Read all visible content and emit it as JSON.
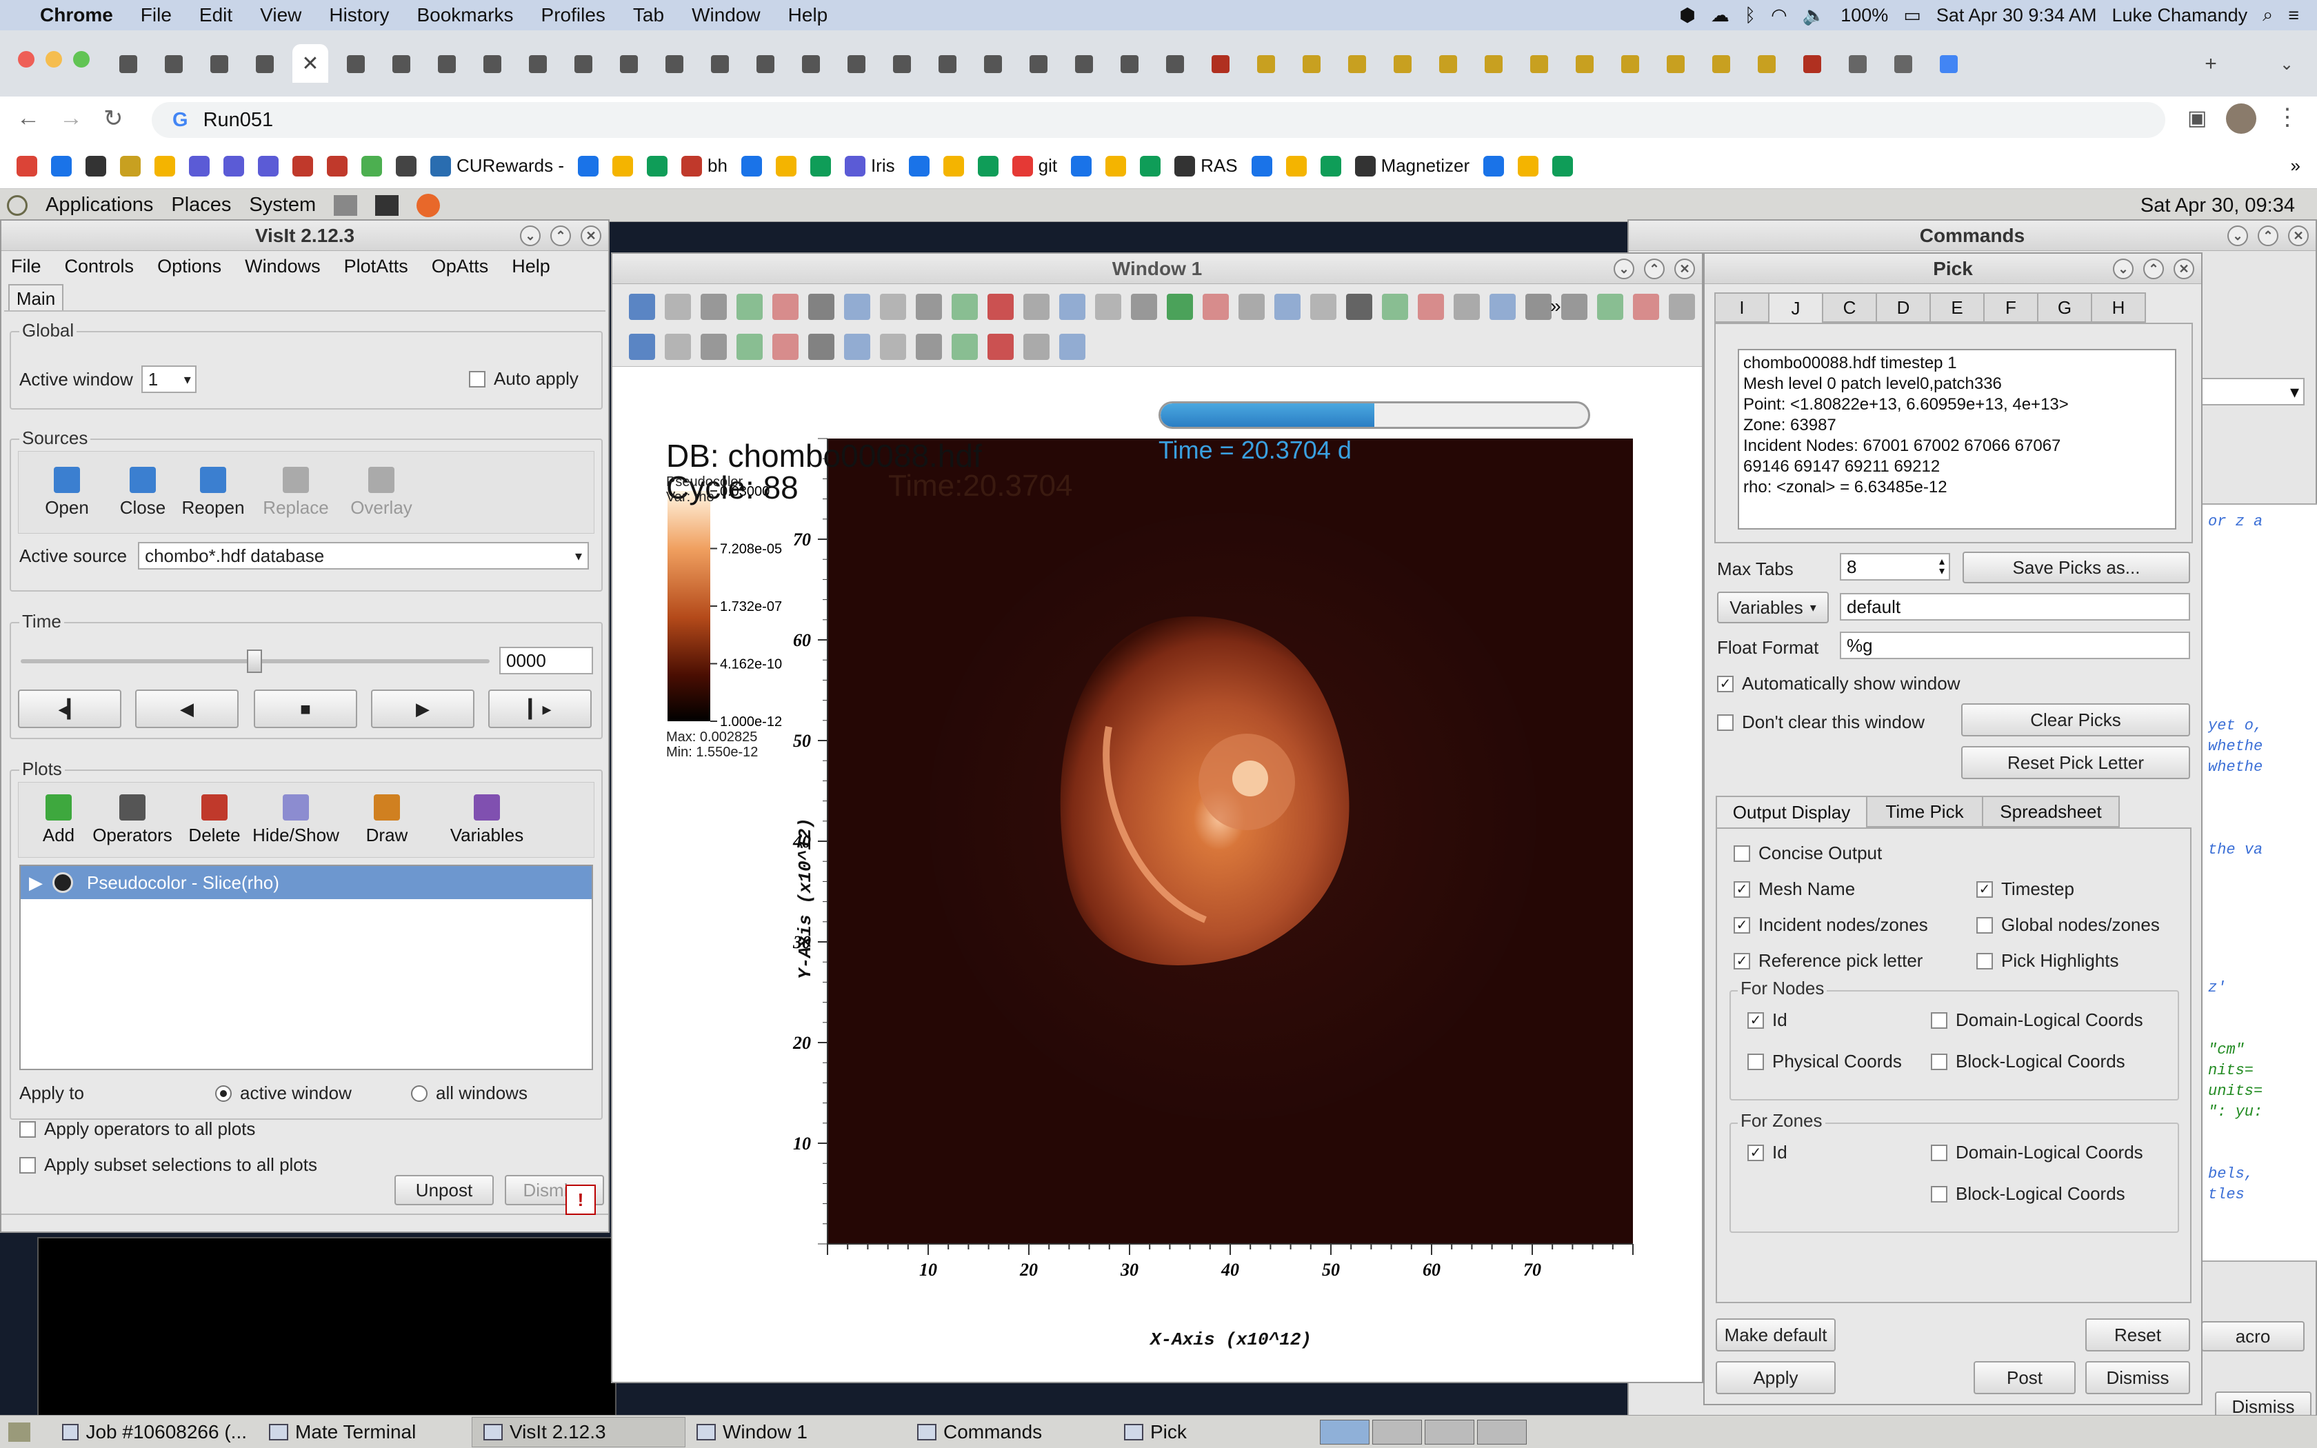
{
  "mac_menubar": {
    "app": "Chrome",
    "menus": [
      "File",
      "Edit",
      "View",
      "History",
      "Bookmarks",
      "Profiles",
      "Tab",
      "Window",
      "Help"
    ],
    "battery": "100%",
    "datetime": "Sat Apr 30  9:34 AM",
    "user": "Luke Chamandy"
  },
  "chrome": {
    "address": "Run051",
    "bookmarks": [
      "CURewards -",
      "bh",
      "Iris",
      "git",
      "RAS",
      "Magnetizer"
    ]
  },
  "mate_panel": {
    "menus": [
      "Applications",
      "Places",
      "System"
    ],
    "clock": "Sat Apr 30, 09:34"
  },
  "visit": {
    "title": "VisIt 2.12.3",
    "menus": [
      "File",
      "Controls",
      "Options",
      "Windows",
      "PlotAtts",
      "OpAtts",
      "Help"
    ],
    "tab": "Main",
    "global_label": "Global",
    "active_window_label": "Active window",
    "active_window_value": "1",
    "auto_apply": "Auto apply",
    "sources_label": "Sources",
    "source_buttons": [
      "Open",
      "Close",
      "Reopen",
      "Replace",
      "Overlay"
    ],
    "active_source_label": "Active source",
    "active_source_value": "chombo*.hdf database",
    "time_label": "Time",
    "time_value": "0000",
    "plots_label": "Plots",
    "plot_buttons": [
      "Add",
      "Operators",
      "Delete",
      "Hide/Show",
      "Draw",
      "Variables"
    ],
    "plot_item": "Pseudocolor - Slice(rho)",
    "apply_to_label": "Apply to",
    "apply_active": "active window",
    "apply_all": "all windows",
    "apply_ops": "Apply operators to all plots",
    "apply_subset": "Apply subset selections to all plots",
    "unpost": "Unpost",
    "dismiss": "Dismiss"
  },
  "window1": {
    "title": "Window 1",
    "db_line": "DB: chombo00088.hdf",
    "cycle_line": "Cycle: 88",
    "time_ghost": "Time:20.3704",
    "time_overlay": "Time = 20.3704 d",
    "progress": 0.5,
    "legend_title": "Pseudocolor",
    "legend_var": "Var: rho",
    "legend_ticks": [
      "0.03000",
      "7.208e-05",
      "1.732e-07",
      "4.162e-10",
      "1.000e-12"
    ],
    "legend_max": "Max:  0.002825",
    "legend_min": "Min:  1.550e-12",
    "y_ticks": [
      "70",
      "60",
      "50",
      "40",
      "30",
      "20",
      "10"
    ],
    "x_ticks": [
      "10",
      "20",
      "30",
      "40",
      "50",
      "60",
      "70"
    ],
    "y_label": "Y-Axis  (x10^12)",
    "x_label": "X-Axis  (x10^12)"
  },
  "commands": {
    "title": "Commands",
    "right_button": "Dismiss",
    "macro_button": "acro",
    "code_snippets": [
      "or z a",
      "yet o,",
      "whethe",
      "whethe",
      "the va",
      "z'",
      "\"cm\"",
      "nits=",
      "units=",
      "\": yu:",
      "bels,",
      "tles"
    ]
  },
  "pick": {
    "title": "Pick",
    "tabs": [
      "I",
      "J",
      "C",
      "D",
      "E",
      "F",
      "G",
      "H"
    ],
    "output_lines": [
      "chombo00088.hdf  timestep 1",
      "Mesh level 0 patch level0,patch336",
      "Point: <1.80822e+13, 6.60959e+13, 4e+13>",
      "Zone:  63987",
      "Incident Nodes:  67001  67002  67066  67067",
      "69146  69147  69211  69212",
      "rho:  <zonal> = 6.63485e-12"
    ],
    "max_tabs_label": "Max Tabs",
    "max_tabs_value": "8",
    "save_picks": "Save Picks as...",
    "variables_btn": "Variables",
    "variables_value": "default",
    "float_format_label": "Float Format",
    "float_format_value": "%g",
    "auto_show": "Automatically show window",
    "dont_clear": "Don't clear this window",
    "clear_picks": "Clear Picks",
    "reset_letter": "Reset Pick Letter",
    "sub_tabs": [
      "Output Display",
      "Time Pick",
      "Spreadsheet"
    ],
    "concise": "Concise Output",
    "mesh_name": "Mesh Name",
    "timestep": "Timestep",
    "incident": "Incident nodes/zones",
    "global_nodes": "Global nodes/zones",
    "ref_letter": "Reference pick letter",
    "pick_highlights": "Pick Highlights",
    "for_nodes": "For Nodes",
    "for_zones": "For Zones",
    "id": "Id",
    "domain_logical": "Domain-Logical Coords",
    "physical": "Physical Coords",
    "block_logical": "Block-Logical Coords",
    "make_default": "Make default",
    "reset": "Reset",
    "apply": "Apply",
    "post": "Post",
    "dismiss": "Dismiss"
  },
  "taskbar": {
    "items": [
      "Job #10608266 (...",
      "Mate Terminal",
      "VisIt 2.12.3",
      "Window 1",
      "Commands",
      "Pick"
    ]
  }
}
